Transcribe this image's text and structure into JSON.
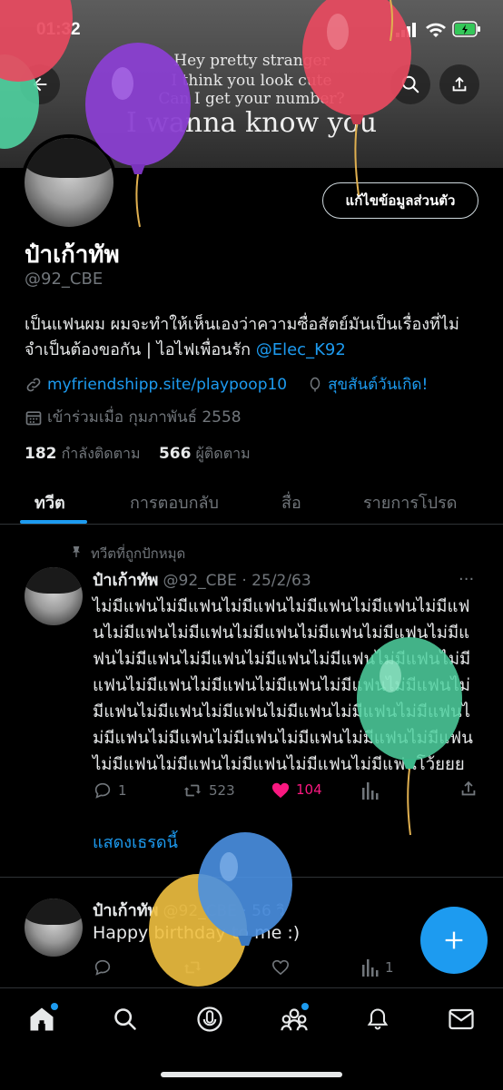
{
  "status_bar": {
    "time": "01:32"
  },
  "banner": {
    "lyric_lines": [
      "Hey pretty stranger",
      "I think you look cute",
      "Can I get your number?",
      "I wanna know you"
    ]
  },
  "profile": {
    "edit_button": "แก้ไขข้อมูลส่วนตัว",
    "name": "ป๋าเก้าทัพ",
    "handle": "@92_CBE",
    "bio_text": "เป็นแฟนผม ผมจะทำให้เห็นเองว่าความซื่อสัตย์มันเป็นเรื่องที่ไม่จำเป็นต้องขอกัน | ไอไฟเพื่อนรัก ",
    "bio_mention": "@Elec_K92",
    "website": "myfriendshipp.site/playpoop10",
    "birthday": "สุขสันต์วันเกิด!",
    "joined": "เข้าร่วมเมื่อ กุมภาพันธ์ 2558",
    "following_count": "182",
    "following_label": "กำลังติดตาม",
    "followers_count": "566",
    "followers_label": "ผู้ติดตาม"
  },
  "tabs": [
    "ทวีต",
    "การตอบกลับ",
    "สื่อ",
    "รายการโปรด"
  ],
  "pinned_tweet": {
    "pin_label": "ทวีตที่ถูกปักหมุด",
    "name": "ป๋าเก้าทัพ",
    "handle_date": "@92_CBE · 25/2/63",
    "text": "ไม่มีแฟนไม่มีแฟนไม่มีแฟนไม่มีแฟนไม่มีแฟนไม่มีแฟนไม่มีแฟนไม่มีแฟนไม่มีแฟนไม่มีแฟนไม่มีแฟนไม่มีแฟนไม่มีแฟนไม่มีแฟนไม่มีแฟนไม่มีแฟนไม่มีแฟนไม่มีแฟนไม่มีแฟนไม่มีแฟนไม่มีแฟนไม่มีแฟนไม่มีแฟนไม่มีแฟนไม่มีแฟนไม่มีแฟนไม่มีแฟนไม่มีแฟนไม่มีแฟนไม่มีแฟนไม่มีแฟนไม่มีแฟนไม่มีแฟนไม่มีแฟนไม่มีแฟนไม่มีแฟนไม่มีแฟนไม่มีแฟนไม่มีแฟนไม่มีแฟนโว้ยยย",
    "replies": "1",
    "retweets": "523",
    "likes": "104",
    "show_thread": "แสดงเธรดนี้"
  },
  "second_tweet": {
    "name": "ป๋าเก้าทัพ",
    "handle_time": "@92_CBE · 56 วิ",
    "text": "Happy birthday to me :)",
    "views": "1"
  },
  "colors": {
    "accent": "#1d9bf0",
    "like": "#f91880",
    "balloon_red": "#e84a5f",
    "balloon_purple": "#8a3fd1",
    "balloon_green": "#4fd1a0",
    "balloon_blue": "#4a90e2",
    "balloon_yellow": "#f0c040"
  }
}
